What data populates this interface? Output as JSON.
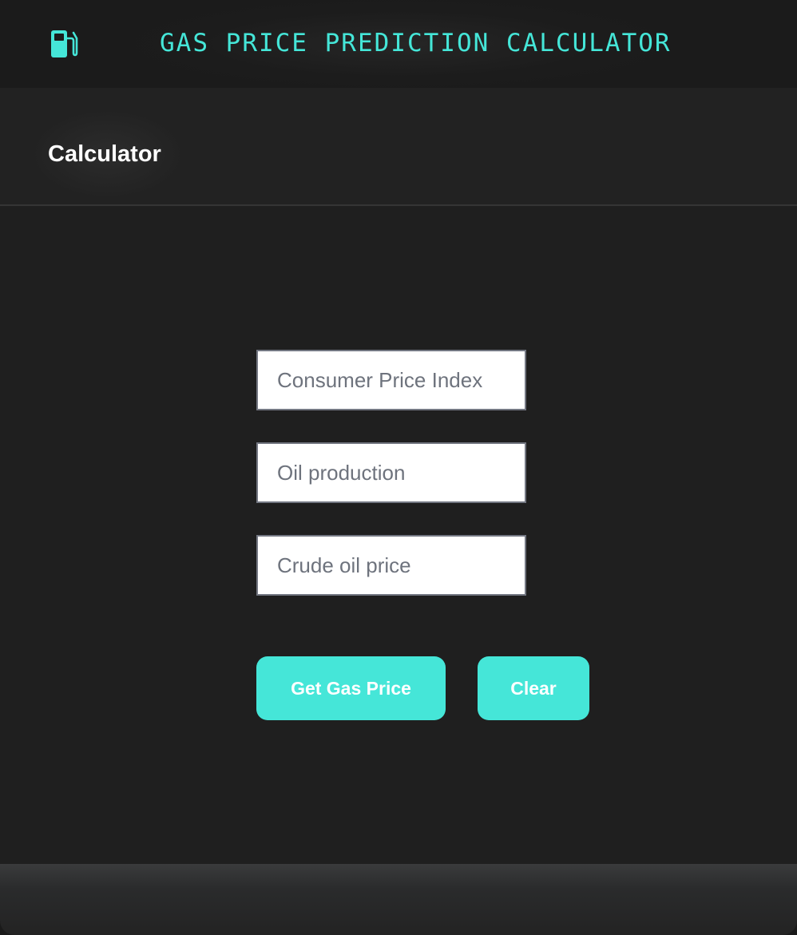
{
  "header": {
    "icon": "gas-pump-icon",
    "title": "GAS PRICE PREDICTION CALCULATOR"
  },
  "section": {
    "title": "Calculator"
  },
  "form": {
    "cpi_placeholder": "Consumer Price Index",
    "oil_production_placeholder": "Oil production",
    "crude_oil_placeholder": "Crude oil price"
  },
  "buttons": {
    "get_price_label": "Get Gas Price",
    "clear_label": "Clear"
  },
  "colors": {
    "accent": "#45e6d8",
    "background": "#1f1f1f",
    "header": "#1c1c1c"
  }
}
